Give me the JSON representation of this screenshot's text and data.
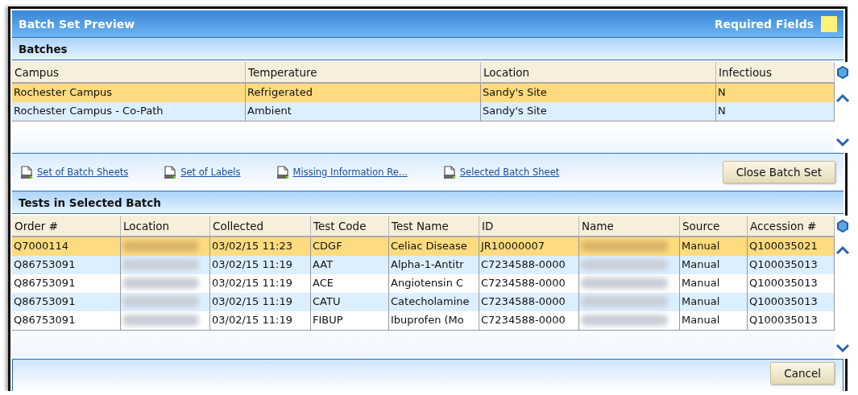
{
  "window": {
    "title": "Batch Set Preview",
    "required_fields_label": "Required Fields"
  },
  "batches": {
    "title": "Batches",
    "columns": [
      "Campus",
      "Temperature",
      "Location",
      "Infectious"
    ],
    "rows": [
      {
        "selected": true,
        "cells": [
          "Rochester Campus",
          "Refrigerated",
          "Sandy's Site",
          "N"
        ]
      },
      {
        "selected": false,
        "cells": [
          "Rochester Campus - Co-Path",
          "Ambient",
          "Sandy's Site",
          "N"
        ]
      }
    ]
  },
  "links": [
    "Set of Batch Sheets",
    "Set of Labels",
    "Missing Information Re...",
    "Selected Batch Sheet"
  ],
  "close_button": "Close Batch Set",
  "tests": {
    "title": "Tests in Selected Batch",
    "columns": [
      "Order #",
      "Location",
      "Collected",
      "Test Code",
      "Test Name",
      "ID",
      "Name",
      "Source",
      "Accession #"
    ],
    "rows": [
      {
        "selected": true,
        "cells": [
          "Q7000114",
          null,
          "03/02/15 11:23",
          "CDGF",
          "Celiac Disease",
          "JR10000007",
          null,
          "Manual",
          "Q100035021"
        ]
      },
      {
        "selected": false,
        "cells": [
          "Q86753091",
          null,
          "03/02/15 11:19",
          "AAT",
          "Alpha-1-Antitr",
          "C7234588-0000",
          null,
          "Manual",
          "Q100035013"
        ]
      },
      {
        "selected": false,
        "cells": [
          "Q86753091",
          null,
          "03/02/15 11:19",
          "ACE",
          "Angiotensin C",
          "C7234588-0000",
          null,
          "Manual",
          "Q100035013"
        ]
      },
      {
        "selected": false,
        "cells": [
          "Q86753091",
          null,
          "03/02/15 11:19",
          "CATU",
          "Catecholamine",
          "C7234588-0000",
          null,
          "Manual",
          "Q100035013"
        ]
      },
      {
        "selected": false,
        "cells": [
          "Q86753091",
          null,
          "03/02/15 11:19",
          "FIBUP",
          "Ibuprofen (Mo",
          "C7234588-0000",
          null,
          "Manual",
          "Q100035013"
        ]
      }
    ]
  },
  "cancel_button": "Cancel"
}
